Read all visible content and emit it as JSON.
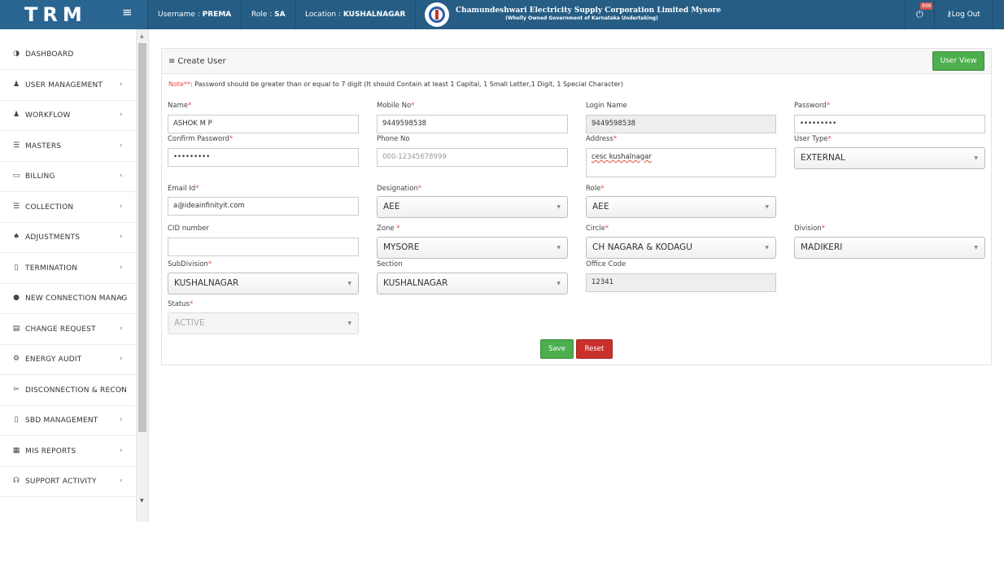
{
  "header": {
    "brand": "TRM",
    "username_label": "Username : ",
    "username": "PREMA",
    "role_label": "Role : ",
    "role": "SA",
    "location_label": "Location : ",
    "location": "KUSHALNAGAR",
    "org_name": "Chamundeshwari Electricity Supply Corporation Limited Mysore",
    "org_sub": "(Wholly Owned Government of Karnataka Undertaking)",
    "notification_count": "898",
    "logout": "Log Out"
  },
  "sidebar": {
    "items": [
      {
        "label": "DASHBOARD",
        "icon": "dashboard-icon",
        "glyph": "◑",
        "chevron": false
      },
      {
        "label": "USER MANAGEMENT",
        "icon": "user-icon",
        "glyph": "♟",
        "chevron": true
      },
      {
        "label": "WORKFLOW",
        "icon": "user-icon",
        "glyph": "♟",
        "chevron": true
      },
      {
        "label": "MASTERS",
        "icon": "list-icon",
        "glyph": "☰",
        "chevron": true
      },
      {
        "label": "BILLING",
        "icon": "monitor-icon",
        "glyph": "▭",
        "chevron": true
      },
      {
        "label": "COLLECTION",
        "icon": "list-icon",
        "glyph": "☰",
        "chevron": true
      },
      {
        "label": "ADJUSTMENTS",
        "icon": "binoculars-icon",
        "glyph": "♠",
        "chevron": true
      },
      {
        "label": "TERMINATION",
        "icon": "trash-icon",
        "glyph": "▯",
        "chevron": true
      },
      {
        "label": "NEW CONNECTION MANAGEMENT",
        "icon": "plus-circle-icon",
        "glyph": "●",
        "chevron": true
      },
      {
        "label": "CHANGE REQUEST",
        "icon": "table-icon",
        "glyph": "▤",
        "chevron": true
      },
      {
        "label": "ENERGY AUDIT",
        "icon": "cogs-icon",
        "glyph": "⚙",
        "chevron": true
      },
      {
        "label": "DISCONNECTION & RECONNECTION",
        "icon": "scissors-icon",
        "glyph": "✂",
        "chevron": true
      },
      {
        "label": "SBD MANAGEMENT",
        "icon": "box-icon",
        "glyph": "▯",
        "chevron": true
      },
      {
        "label": "MIS REPORTS",
        "icon": "chart-icon",
        "glyph": "▦",
        "chevron": true
      },
      {
        "label": "SUPPORT ACTIVITY",
        "icon": "headphones-icon",
        "glyph": "☊",
        "chevron": true
      }
    ]
  },
  "panel": {
    "title": "Create User",
    "user_view_button": "User View"
  },
  "note": {
    "prefix": "Note**",
    "text": ": Password should be greater than or equal to 7 digit (It should Contain at least 1 Capital, 1 Small Letter,1 Digit, 1 Special Character)"
  },
  "form": {
    "name": {
      "label": "Name",
      "value": "ASHOK M P"
    },
    "mobile": {
      "label": "Mobile No",
      "value": "9449598538"
    },
    "login_name": {
      "label": "Login Name",
      "value": "9449598538"
    },
    "password": {
      "label": "Password",
      "value": "•••••••••"
    },
    "confirm_password": {
      "label": "Confirm Password",
      "value": "•••••••••"
    },
    "phone": {
      "label": "Phone No",
      "placeholder": "000-12345678999"
    },
    "address": {
      "label": "Address",
      "value": "cesc kushalnagar"
    },
    "user_type": {
      "label": "User Type",
      "value": "EXTERNAL"
    },
    "email": {
      "label": "Email Id",
      "value": "a@ideainfinityit.com"
    },
    "designation": {
      "label": "Designation",
      "value": "AEE"
    },
    "role": {
      "label": "Role",
      "value": "AEE"
    },
    "cid": {
      "label": "CID number",
      "value": ""
    },
    "zone": {
      "label": "Zone ",
      "value": "MYSORE"
    },
    "circle": {
      "label": "Circle",
      "value": "CH NAGARA & KODAGU"
    },
    "division": {
      "label": "Division",
      "value": "MADIKERI"
    },
    "subdivision": {
      "label": "SubDivision",
      "value": "KUSHALNAGAR"
    },
    "section": {
      "label": "Section",
      "value": "KUSHALNAGAR"
    },
    "office_code": {
      "label": "Office Code",
      "value": "12341"
    },
    "status": {
      "label": "Status",
      "value": "ACTIVE"
    },
    "required_mark": "*",
    "save": "Save",
    "reset": "Reset"
  },
  "colors": {
    "header_bg": "#255d85",
    "success": "#4cae4c",
    "danger": "#c9302c",
    "required": "#e74c3c"
  }
}
